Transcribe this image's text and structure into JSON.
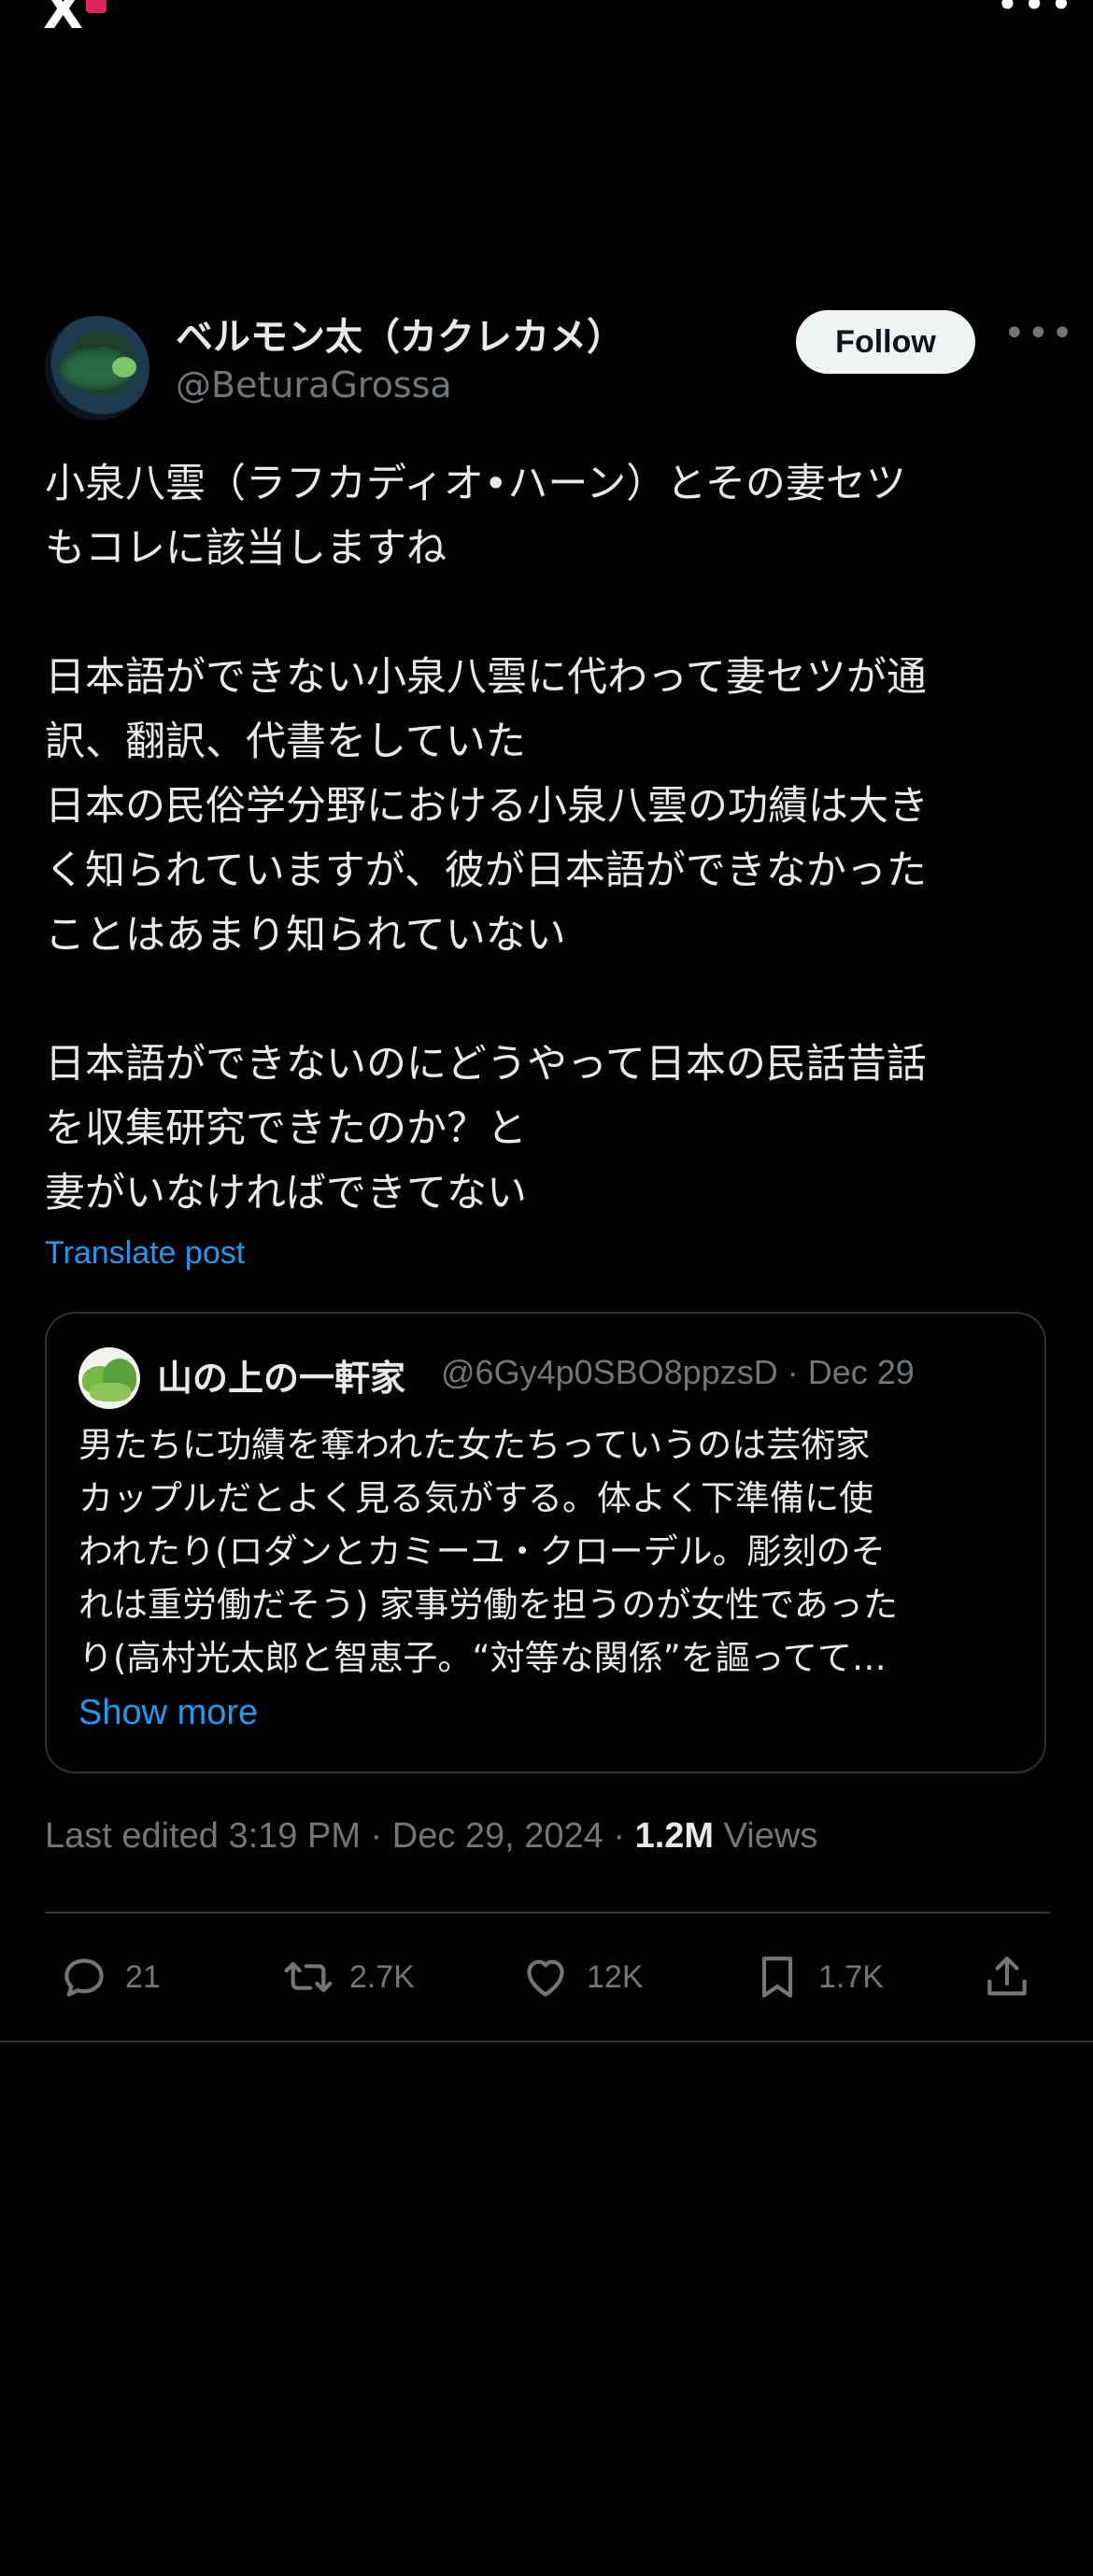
{
  "app": {
    "logo_text": "X",
    "more_label": "•••"
  },
  "post": {
    "author_name": "ベルモン太（カクレカメ）",
    "author_handle": "@BeturaGrossa",
    "follow_label": "Follow",
    "more_label": "•••",
    "body_lines": [
      "小泉八雲（ラフカディオ•ハーン）とその妻セツ",
      "もコレに該当しますね",
      "",
      "日本語ができない小泉八雲に代わって妻セツが通",
      "訳、翻訳、代書をしていた",
      "日本の民俗学分野における小泉八雲の功績は大き",
      "く知られていますが、彼が日本語ができなかった",
      "ことはあまり知られていない",
      "",
      "日本語ができないのにどうやって日本の民話昔話",
      "を収集研究できたのか？と",
      "妻がいなければできてない"
    ],
    "translate_label": "Translate post",
    "meta": {
      "edited": "Last edited 3:19 PM · Dec 29, 2024 · ",
      "views_count": "1.2M",
      "views_label": " Views"
    },
    "actions": {
      "replies": "21",
      "reposts": "2.7K",
      "likes": "12K",
      "bookmarks": "1.7K"
    }
  },
  "quoted": {
    "author_name": "山の上の一軒家",
    "handle_date": "@6Gy4p0SBO8ppzsD · Dec 29",
    "text_lines": [
      "男たちに功績を奪われた女たちっていうのは芸術家",
      "カップルだとよく見る気がする。体よく下準備に使",
      "われたり(ロダンとカミーユ・クローデル。彫刻のそ",
      "れは重労働だそう) 家事労働を担うのが女性であった",
      "り(高村光太郎と智恵子。“対等な関係”を謳ってて…"
    ],
    "show_more_label": "Show more"
  },
  "colors": {
    "background": "#000000",
    "text": "#e7e9ea",
    "secondary": "#71767b",
    "accent": "#1d9bf0",
    "border": "#2f3336"
  }
}
